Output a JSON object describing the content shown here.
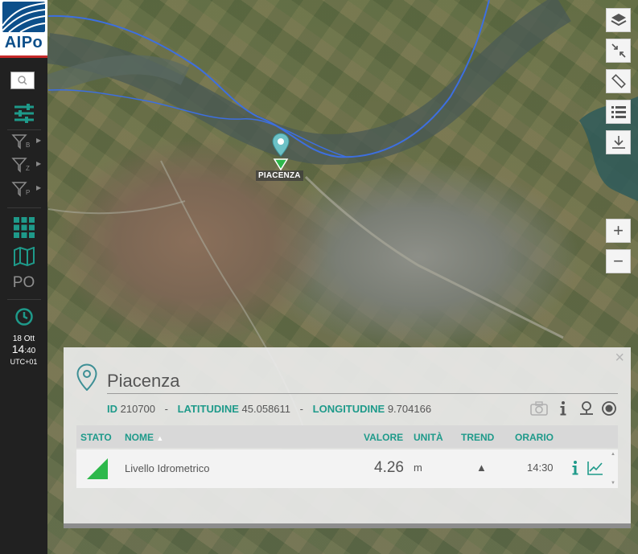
{
  "app": {
    "logo_text": "AIPo"
  },
  "sidebar": {
    "icons": [
      "search-icon",
      "sliders-icon",
      "filter-icon",
      "grid-icon",
      "map-icon",
      "clock-icon"
    ],
    "filters": [
      {
        "sub": "B"
      },
      {
        "sub": "Z"
      },
      {
        "sub": "P"
      }
    ],
    "po_label": "PO",
    "date": "18 Ott",
    "time_hour": "14",
    "time_min": ":40",
    "timezone": "UTC+01"
  },
  "map": {
    "marker_label": "PIACENZA",
    "controls": [
      "layers-icon",
      "collapse-icon",
      "ruler-icon",
      "list-icon",
      "download-icon"
    ],
    "zoom_in": "+",
    "zoom_out": "−"
  },
  "panel": {
    "close": "×",
    "title": "Piacenza",
    "id_label": "ID",
    "id_value": "210700",
    "lat_label": "LATITUDINE",
    "lat_value": "45.058611",
    "lon_label": "LONGITUDINE",
    "lon_value": "9.704166",
    "sep": "-",
    "table": {
      "headers": {
        "stato": "STATO",
        "nome": "NOME",
        "sort": "▲",
        "valore": "VALORE",
        "unita": "UNITÀ",
        "trend": "TREND",
        "orario": "ORARIO"
      },
      "rows": [
        {
          "nome": "Livello Idrometrico",
          "valore": "4.26",
          "unita": "m",
          "trend": "▲",
          "orario": "14:30"
        }
      ]
    }
  },
  "colors": {
    "accent": "#1e9a8a",
    "status_ok": "#2db84b",
    "brand": "#0d4f8a",
    "brand_red": "#c62828"
  }
}
